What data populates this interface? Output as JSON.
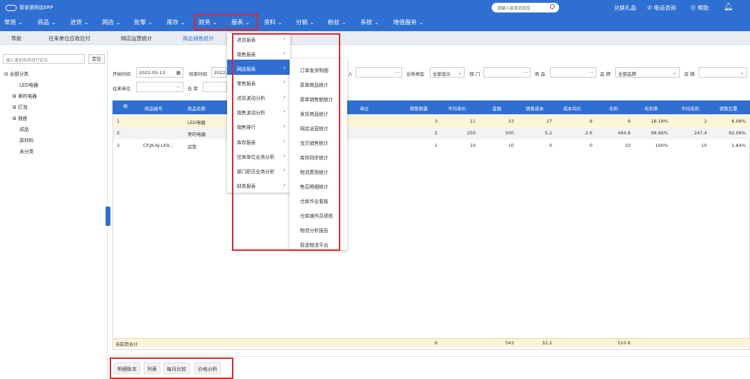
{
  "app": {
    "name": "管家婆网店ERP"
  },
  "topright": {
    "search_placeholder": "请输入菜单名回车",
    "gift": "兑换礼品",
    "phone": "电话咨询",
    "help": "帮助"
  },
  "menu": [
    "常用",
    "商品",
    "进货",
    "网店",
    "批零",
    "库存",
    "财务",
    "报表",
    "资料",
    "分销",
    "粉丝",
    "系统",
    "增值服务"
  ],
  "tabs": [
    "导航",
    "往来单位应收应付",
    "网店运营统计",
    "商品销售统计"
  ],
  "tree": {
    "placeholder": "输入类别名称进行定位",
    "locate": "定位",
    "root": "全部分类",
    "items": [
      "LED电器",
      "美的电器",
      "灯泡",
      "插座",
      "成品",
      "原材料",
      "未分类"
    ]
  },
  "filters": {
    "start_label": "开始时间",
    "start_value": "2022-05-13",
    "end_label": "结束时间",
    "end_value": "2022-",
    "partial_person": "人",
    "biz_label": "业务类型",
    "biz_value": "全部显示",
    "dept_label": "部 门",
    "goods_label": "商 品",
    "brand_label": "品 牌",
    "brand_value": "全部品牌",
    "shop_label": "店 铺",
    "partner_label": "往来单位",
    "wh_label": "仓 库"
  },
  "table": {
    "headers": [
      "商品编号",
      "商品名称",
      "单位",
      "销售数量",
      "平均单价",
      "金额",
      "销售成本",
      "成本均价",
      "毛利",
      "毛利率",
      "平均毛利",
      "销售比重"
    ],
    "rows": [
      {
        "idx": "1.",
        "code": "",
        "name": "LED电器",
        "qty": "3",
        "price": "11",
        "amount": "33",
        "cost": "27",
        "cost_avg": "9",
        "profit": "6",
        "rate": "18.18%",
        "avg_profit": "2",
        "share": "6.08%"
      },
      {
        "idx": "2.",
        "code": "",
        "name": "美的电器",
        "qty": "2",
        "price": "250",
        "amount": "500",
        "cost": "5.2",
        "cost_avg": "2.6",
        "profit": "494.8",
        "rate": "98.96%",
        "avg_profit": "247.4",
        "share": "92.08%"
      },
      {
        "idx": "3",
        "code": "CP.JK-AJ-LK9...",
        "name": "运营",
        "qty": "1",
        "price": "10",
        "amount": "10",
        "cost": "0",
        "cost_avg": "0",
        "profit": "10",
        "rate": "100%",
        "avg_profit": "10",
        "share": "1.84%"
      }
    ],
    "summary": {
      "label": "当前页合计",
      "qty": "6",
      "amount": "543",
      "cost": "32.2",
      "profit": "510.8"
    }
  },
  "bottom_buttons": [
    "明细账本",
    "列表",
    "每月比较",
    "价格分析"
  ],
  "report_menu": [
    "进货报表",
    "销售报表",
    "网店报表",
    "零售报表",
    "进货波动分析",
    "销售波动分析",
    "销售排行",
    "库存报表",
    "往来单位业务分析",
    "部门职员业务分析",
    "财务报表"
  ],
  "report_submenu": [
    "订单发货明细",
    "原单商品统计",
    "原单销售额统计",
    "发货商品统计",
    "网店运营统计",
    "宝贝销售统计",
    "库存同步统计",
    "物流费用统计",
    "售后明细统计",
    "仓库作业看板",
    "仓库操作员绩效",
    "物流分析报告",
    "智选物流平台"
  ],
  "colors": {
    "brand": "#2f6fd1",
    "highlight": "#e12424",
    "row_highlight": "#fdf5d8"
  }
}
